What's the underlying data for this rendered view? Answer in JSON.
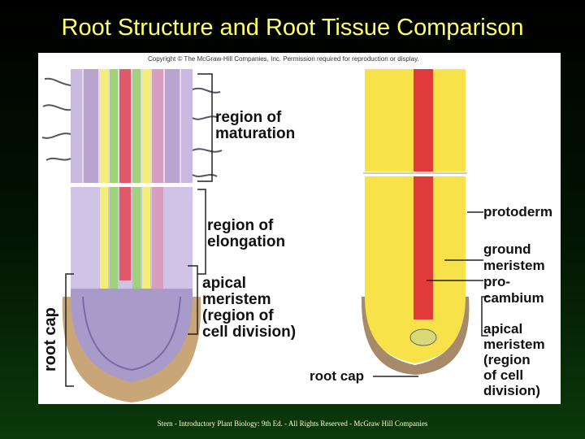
{
  "slide": {
    "title": "Root Structure and Root Tissue Comparison",
    "footer": "Stern - Introductory Plant Biology: 9th Ed. - All Rights Reserved - McGraw Hill Companies"
  },
  "figure": {
    "copyright": "Copyright © The McGraw-Hill Companies, Inc. Permission required for reproduction or display.",
    "left_labels": {
      "maturation": [
        "region of",
        "maturation"
      ],
      "elongation": [
        "region of",
        "elongation"
      ],
      "apical": [
        "apical",
        "meristem",
        "(region of",
        "cell division)"
      ],
      "root_cap": "root cap"
    },
    "right_labels": {
      "protoderm": "protoderm",
      "ground": [
        "ground",
        "meristem"
      ],
      "procambium": [
        "pro-",
        "cambium"
      ],
      "apical": [
        "apical",
        "meristem",
        "(region",
        "of cell",
        "division)"
      ],
      "root_cap": "root cap"
    }
  }
}
